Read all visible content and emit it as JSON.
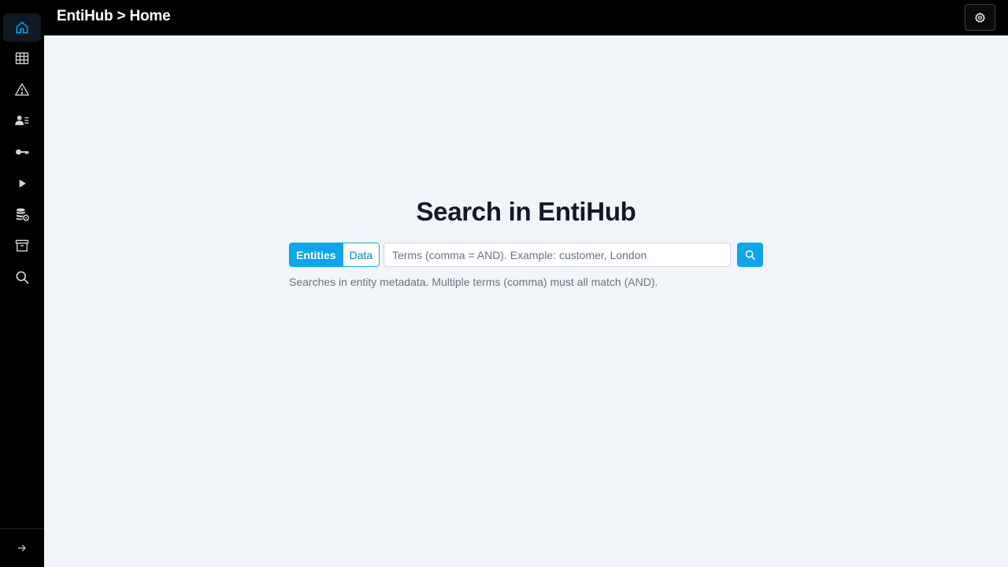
{
  "topbar": {
    "breadcrumb": "EntiHub > Home",
    "settings_icon": "gear-icon"
  },
  "sidebar": {
    "items": [
      {
        "icon": "home-icon",
        "active": true
      },
      {
        "icon": "table-icon",
        "active": false
      },
      {
        "icon": "warning-icon",
        "active": false
      },
      {
        "icon": "user-list-icon",
        "active": false
      },
      {
        "icon": "key-icon",
        "active": false
      },
      {
        "icon": "play-icon",
        "active": false
      },
      {
        "icon": "database-settings-icon",
        "active": false
      },
      {
        "icon": "archive-icon",
        "active": false
      },
      {
        "icon": "search-icon",
        "active": false
      }
    ],
    "expand_icon": "arrow-right-icon"
  },
  "main": {
    "title": "Search in EntiHub",
    "toggle": {
      "options": [
        "Entities",
        "Data"
      ],
      "selected": "Entities"
    },
    "search": {
      "value": "",
      "placeholder": "Terms (comma = AND). Example: customer, London"
    },
    "hint": "Searches in entity metadata. Multiple terms (comma) must all match (AND)."
  },
  "colors": {
    "accent": "#0ea5e9",
    "sidebar_bg": "#000000",
    "page_bg": "#f1f5f9",
    "active_icon": "#0ea5e9"
  }
}
